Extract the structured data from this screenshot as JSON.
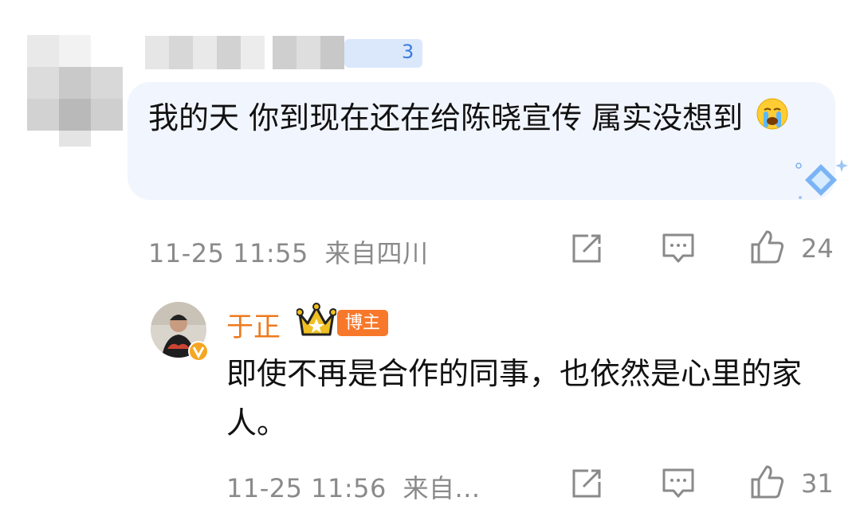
{
  "comment": {
    "username_badge": "3",
    "text": "我的天 你到现在还在给陈晓宣传 属实没想到",
    "emoji": "loudly-crying-face",
    "timestamp": "11-25 11:55",
    "location": "来自四川",
    "like_count": "24"
  },
  "reply": {
    "author": "于正",
    "author_tag": "博主",
    "text": "即使不再是合作的同事，也依然是心里的家人。",
    "timestamp": "11-25 11:56",
    "location": "来自...",
    "like_count": "31"
  },
  "colors": {
    "bubble_bg": "#f1f5fd",
    "meta_gray": "#8a8a8a",
    "reply_name": "#ee7a1e",
    "tag_orange": "#f7782a"
  },
  "icons": [
    "share-icon",
    "comment-icon",
    "like-icon",
    "crown-badge-icon",
    "verified-badge-icon",
    "diamond-decoration-icon"
  ]
}
